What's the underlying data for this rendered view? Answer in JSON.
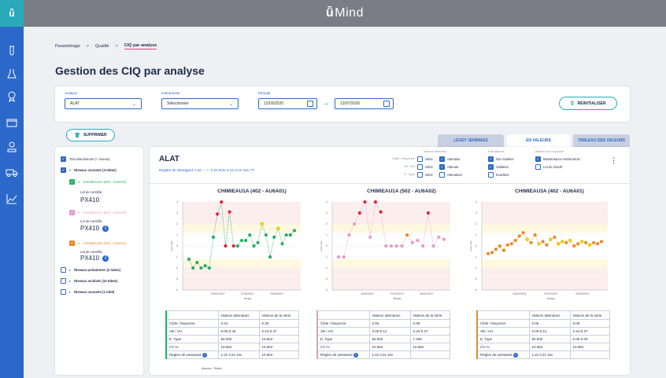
{
  "app": {
    "title": "Mind",
    "logo_glyph": "ǖ"
  },
  "colors": {
    "primary": "#2c68c9",
    "teal": "#2aa9b9",
    "green": "#27ae60",
    "pink": "#e89acb",
    "orange": "#e8892a",
    "red": "#e0253a",
    "yellow": "#f2d200"
  },
  "sidebar": {
    "items": [
      "test-tube-icon",
      "flask-icon",
      "medal-icon",
      "monitor-icon",
      "user-icon",
      "truck-icon",
      "chart-icon"
    ]
  },
  "breadcrumb": {
    "item1": "Paramétrage",
    "item2": "Qualité",
    "item3": "CIQ par analyse"
  },
  "page_title": "Gestion des CIQ par analyse",
  "filters": {
    "analyse_label": "Analyse",
    "analyse_value": "ALAT",
    "instruments_label": "Instruments",
    "instruments_value": "Sélectionner",
    "periode_label": "Période",
    "date_start": "12/03/2020",
    "date_end": "12/07/2020",
    "reset_label": "RÉINITIALISER"
  },
  "supprimer_label": "SUPPRIMER",
  "tabs": [
    "LEVEY JENNINGS",
    "EN VALEURS",
    "TABLEAU DES VALEURS"
  ],
  "tree": {
    "select_all": "Tout sélectionner (+ niveau)",
    "group_current": "Niveaux courants (3 tubes)",
    "items": [
      {
        "name": "CHIMIEAU1A (402 - AU6A01)",
        "lot_label": "Lot de contrôle",
        "lot": "PX410"
      },
      {
        "name": "CHIMIEAU1A (502 - AU6A02)",
        "lot_label": "Lot de contrôle",
        "lot": "PX410"
      },
      {
        "name": "CHIMIEAU3A (402 - AU6A01)",
        "lot_label": "Lot de contrôle",
        "lot": "PX410"
      }
    ],
    "group_probatoires": "Niveaux probatoires (2 tubes)",
    "group_archives": "Niveaux archivés (10 tubes)",
    "group_courants": "Niveaux courants (1 tube)"
  },
  "main": {
    "title": "ALAT",
    "westgard_prefix": "Règles de Westgard 1:2s",
    "westgard_faded": "1:3s",
    "westgard_rest": "2:2s R4s 4:1s 3:1s 10x 7T"
  },
  "display": {
    "values_title": "Valeurs affichées",
    "etat_title": "Etat affichés",
    "graph_title": "Afficher sur le graphe",
    "rows": [
      {
        "label": "Cible / Moyenne",
        "a": "Série",
        "b": "Attendue"
      },
      {
        "label": "VB / VH",
        "a": "Série",
        "b": "Attendu"
      },
      {
        "label": "E. Type",
        "a": "Série",
        "b": "Attendues"
      }
    ],
    "etats": [
      "Non traitées",
      "Validées",
      "Ecartées"
    ],
    "graph": [
      "Maintenance instruments",
      "Lot de réactif"
    ]
  },
  "chart_data": [
    {
      "type": "scatter",
      "title": "CHIMIEAU1A (402 - AU6A01)",
      "color": "#27ae60",
      "xlabel": "temps",
      "ylabel": "écart type",
      "x_ticks": [
        "20/02/2017",
        "27/02/2017",
        "04/03/2017"
      ],
      "ylim": [
        -4,
        4
      ],
      "y_ticks": [
        "4",
        "3",
        "2",
        "1",
        "0",
        "-1",
        "-2",
        "-3",
        "-4"
      ],
      "values": [
        -1.2,
        -2.0,
        -1.5,
        -2.0,
        -1.8,
        -2.0,
        0.8,
        2.9,
        4.0,
        0.0,
        3.1,
        0.0,
        0.0,
        0.5,
        0.5,
        1.0,
        0.0,
        0.3,
        2.0,
        1.0,
        -1.0,
        0.8,
        1.6,
        0.2,
        1.0,
        1.0,
        1.4
      ],
      "point_colors": [
        "g",
        "g",
        "g",
        "g",
        "g",
        "g",
        "g",
        "r",
        "r",
        "r",
        "r",
        "r",
        "g",
        "g",
        "g",
        "g",
        "g",
        "g",
        "y",
        "g",
        "g",
        "g",
        "y",
        "g",
        "g",
        "g",
        "g"
      ]
    },
    {
      "type": "scatter",
      "title": "CHIMIEAU1A (502 - AU6A02)",
      "color": "#e89acb",
      "xlabel": "temps",
      "ylabel": "écart type",
      "x_ticks": [
        "20/02/2017",
        "27/02/2017",
        "04/03/2017"
      ],
      "ylim": [
        -4,
        4
      ],
      "y_ticks": [
        "4",
        "3",
        "2",
        "1",
        "0",
        "-1",
        "-2",
        "-3",
        "-4"
      ],
      "values": [
        -1.0,
        -1.0,
        1.0,
        2.0,
        3.0,
        4.0,
        0.8,
        4.0,
        3.1,
        0.0,
        0.0,
        0.0,
        0.0,
        1.0,
        0.3,
        0.5,
        0.0,
        3.0,
        0.0,
        0.8,
        0.6
      ],
      "point_colors": [
        "p",
        "p",
        "p",
        "p",
        "r",
        "r",
        "p",
        "r",
        "r",
        "p",
        "p",
        "p",
        "p",
        "o",
        "p",
        "p",
        "p",
        "r",
        "p",
        "p",
        "p"
      ]
    },
    {
      "type": "scatter",
      "title": "CHIMIEAU3A (402 - AU6A01)",
      "color": "#e8892a",
      "xlabel": "temps",
      "ylabel": "écart type",
      "x_ticks": [
        "22/02/2011",
        "27/02/2017",
        "04/03/2017"
      ],
      "ylim": [
        -4,
        4
      ],
      "y_ticks": [
        "4",
        "3",
        "2",
        "1",
        "0",
        "-1",
        "-2",
        "-3",
        "-4"
      ],
      "values": [
        -0.7,
        -0.6,
        -0.3,
        0.0,
        -0.4,
        0.1,
        0.2,
        0.5,
        0.9,
        1.2,
        0.6,
        0.3,
        1.0,
        0.2,
        0.4,
        0.1,
        0.6,
        0.8,
        0.2,
        0.4,
        0.3,
        0.5,
        0.0,
        0.2,
        0.4,
        0.3,
        0.1,
        0.3,
        0.2,
        0.4
      ],
      "point_colors": [
        "o",
        "o",
        "o",
        "o",
        "o",
        "o",
        "o",
        "o",
        "o",
        "o",
        "y",
        "o",
        "o",
        "y",
        "o",
        "o",
        "y",
        "o",
        "y",
        "y",
        "o",
        "y",
        "o",
        "o",
        "y",
        "o",
        "y",
        "o",
        "o",
        "o"
      ]
    }
  ],
  "tables": [
    {
      "header": [
        "",
        "Valeurs attendues",
        "Valeurs de la série"
      ],
      "rows": [
        [
          "Cible / Moyenne",
          "0.24",
          "0.30"
        ],
        [
          "VB / VH",
          "0.00-0.48",
          "0.24-0.37"
        ],
        [
          "E. Type",
          "50.000",
          "10.654"
        ],
        [
          "CV %",
          "10.654",
          "10.654"
        ],
        [
          "Règles de westward",
          "1:2s 2:2s 10x",
          "10.654"
        ]
      ]
    },
    {
      "header": [
        "",
        "Valeurs attendues",
        "Valeurs de la série"
      ],
      "rows": [
        [
          "Cible / Moyenne",
          "0.06",
          "0.08"
        ],
        [
          "VB / VH",
          "0.00-0.12",
          "0.24-0.37"
        ],
        [
          "E. Type",
          "50.000",
          "7.259"
        ],
        [
          "CV %",
          "10.654",
          "10.654"
        ],
        [
          "Règles de westward",
          "1:2s 2:2s 10x",
          ""
        ]
      ]
    },
    {
      "header": [
        "",
        "Valeurs attendues",
        "Valeurs de la série"
      ],
      "rows": [
        [
          "Cible / Moyenne",
          "0.06",
          "0.08"
        ],
        [
          "VB / VH",
          "0.00-0.12",
          "0.24-0.37"
        ],
        [
          "E. Type",
          "50.000",
          "0.06-0.09"
        ],
        [
          "CV %",
          "10.654",
          "10.654"
        ],
        [
          "Règles de westward",
          "1:2s 2:2s 10x",
          ""
        ]
      ]
    }
  ],
  "tooltip": "Alarmes : Rejets"
}
